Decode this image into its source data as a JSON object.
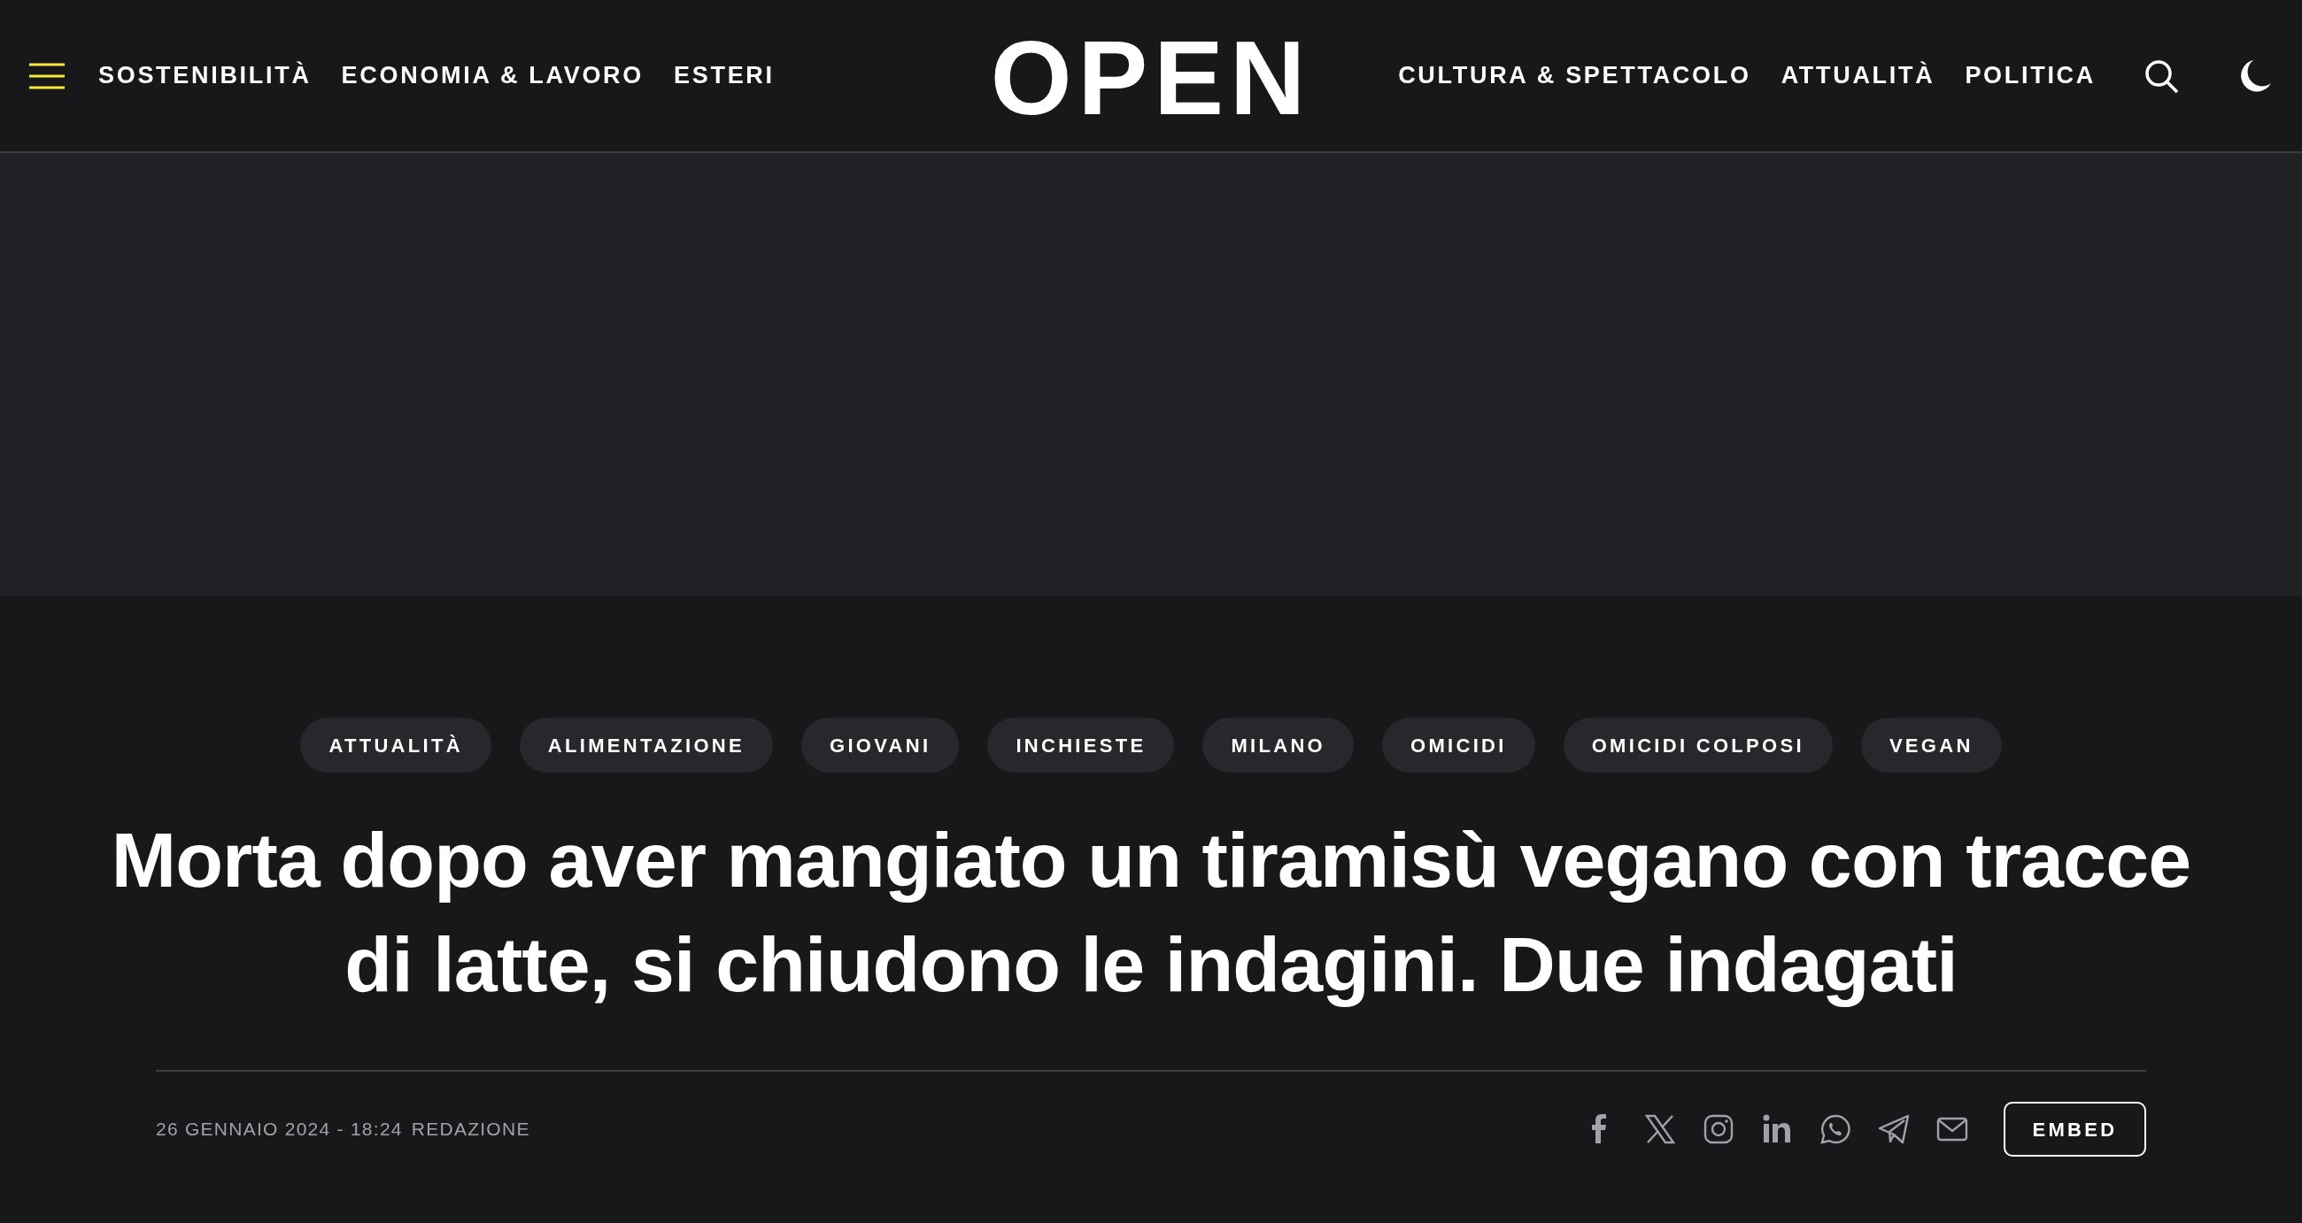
{
  "header": {
    "nav_left": [
      "SOSTENIBILITÀ",
      "ECONOMIA & LAVORO",
      "ESTERI"
    ],
    "logo": "OPEN",
    "nav_right": [
      "CULTURA & SPETTACOLO",
      "ATTUALITÀ",
      "POLITICA"
    ]
  },
  "article": {
    "tags": [
      "ATTUALITÀ",
      "ALIMENTAZIONE",
      "GIOVANI",
      "INCHIESTE",
      "MILANO",
      "OMICIDI",
      "OMICIDI COLPOSI",
      "VEGAN"
    ],
    "title": "Morta dopo aver mangiato un tiramisù vegano con tracce di latte, si chiudono le indagini. Due indagati",
    "date": "26 GENNAIO 2024 - 18:24",
    "author": "REDAZIONE",
    "share": [
      {
        "kind": "facebook"
      },
      {
        "kind": "x"
      },
      {
        "kind": "instagram"
      },
      {
        "kind": "linkedin"
      },
      {
        "kind": "whatsapp"
      },
      {
        "kind": "telegram"
      },
      {
        "kind": "email"
      }
    ],
    "embed_button": "EMBED"
  }
}
